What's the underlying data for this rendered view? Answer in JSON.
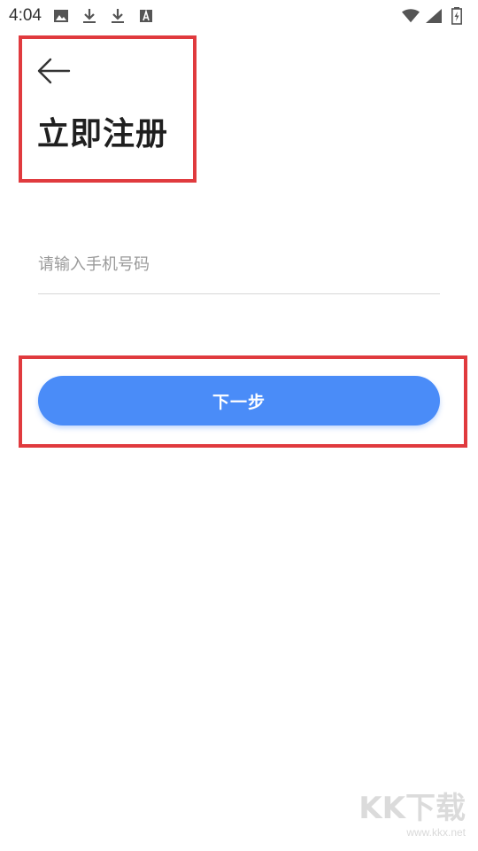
{
  "status_bar": {
    "time": "4:04",
    "icons": [
      "image-icon",
      "download-icon",
      "download-icon",
      "a-text-icon"
    ],
    "right_icons": [
      "wifi-icon",
      "signal-icon",
      "battery-icon"
    ]
  },
  "header": {
    "back_icon": "arrow-left-icon",
    "title": "立即注册"
  },
  "form": {
    "phone_placeholder": "请输入手机号码",
    "phone_value": ""
  },
  "actions": {
    "next_label": "下一步"
  },
  "watermark": {
    "logo": "KK下载",
    "url": "www.kkx.net"
  },
  "colors": {
    "accent": "#4a8cf8",
    "highlight": "#e03a3e"
  }
}
